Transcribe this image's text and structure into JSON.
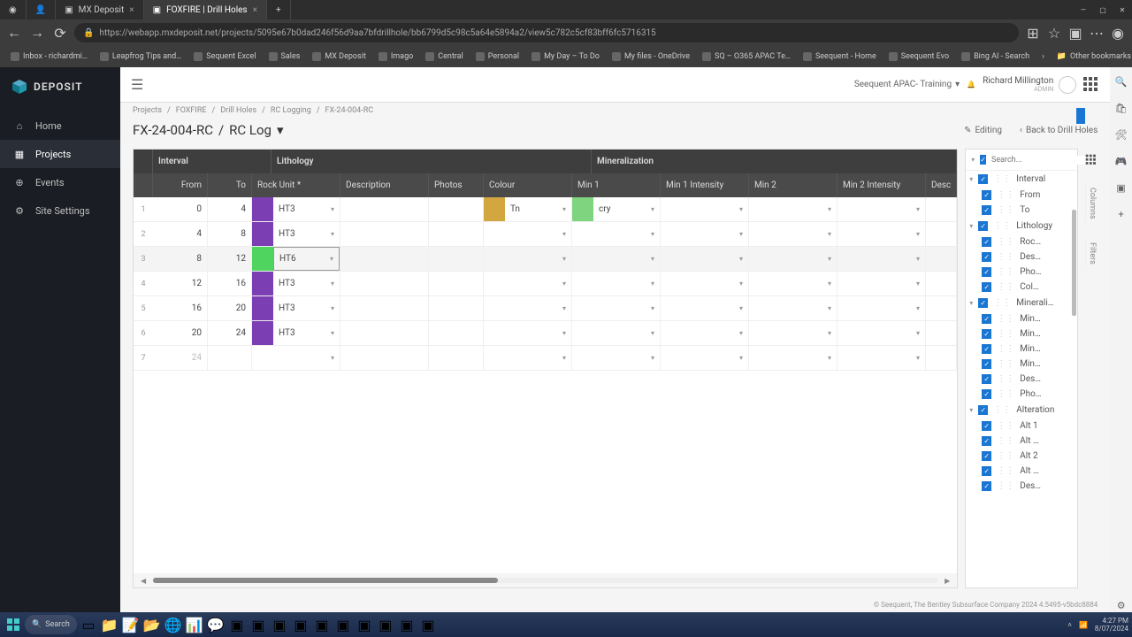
{
  "browser": {
    "tabs": [
      {
        "title": "MX Deposit",
        "active": false
      },
      {
        "title": "FOXFIRE | Drill Holes",
        "active": true
      }
    ],
    "url": "https://webapp.mxdeposit.net/projects/5095e67b0dad246f56d9aa7bfdrillhole/bb6799d5c98c5a64e5894a2/view5c782c5cf83bff6fc5716315",
    "bookmarks": [
      "Inbox - richardmi…",
      "Leapfrog Tips and…",
      "Sequent Excel",
      "Sales",
      "MX Deposit",
      "Imago",
      "Central",
      "Personal",
      "My Day – To Do",
      "My files - OneDrive",
      "SQ – O365 APAC Te…",
      "Seequent - Home",
      "Seequent Evo",
      "Bing AI - Search"
    ],
    "other_bookmarks": "Other bookmarks"
  },
  "app": {
    "logo_text": "DEPOSIT",
    "nav": [
      {
        "label": "Home"
      },
      {
        "label": "Projects",
        "active": true
      },
      {
        "label": "Events"
      },
      {
        "label": "Site Settings"
      }
    ],
    "org_selector": "Seequent APAC- Training",
    "user": {
      "name": "Richard Millington",
      "role": "ADMIN"
    }
  },
  "breadcrumb": [
    "Projects",
    "FOXFIRE",
    "Drill Holes",
    "RC Logging",
    "FX-24-004-RC"
  ],
  "page": {
    "title_a": "FX-24-004-RC",
    "title_b": "RC Log",
    "editing_label": "Editing",
    "back_label": "Back to Drill Holes"
  },
  "table": {
    "groups": [
      "Interval",
      "Lithology",
      "Mineralization"
    ],
    "columns": [
      "From",
      "To",
      "Rock Unit *",
      "Description",
      "Photos",
      "Colour",
      "Min 1",
      "Min 1 Intensity",
      "Min 2",
      "Min 2 Intensity",
      "Desc"
    ],
    "rows": [
      {
        "idx": 1,
        "from": 0,
        "to": 4,
        "rock": "HT3",
        "rock_color": "#7b3fb3",
        "colour": "Tn",
        "colour_swatch": "#d4a640",
        "min1": "cry",
        "min1_swatch": "#7fd47f"
      },
      {
        "idx": 2,
        "from": 4,
        "to": 8,
        "rock": "HT3",
        "rock_color": "#7b3fb3"
      },
      {
        "idx": 3,
        "from": 8,
        "to": 12,
        "rock": "HT6",
        "rock_color": "#4fd45f",
        "selected": true
      },
      {
        "idx": 4,
        "from": 12,
        "to": 16,
        "rock": "HT3",
        "rock_color": "#7b3fb3"
      },
      {
        "idx": 5,
        "from": 16,
        "to": 20,
        "rock": "HT3",
        "rock_color": "#7b3fb3"
      },
      {
        "idx": 6,
        "from": 20,
        "to": 24,
        "rock": "HT3",
        "rock_color": "#7b3fb3"
      }
    ],
    "ghost_row": {
      "idx": 7,
      "from": 24
    }
  },
  "columns_panel": {
    "search_placeholder": "Search...",
    "groups": [
      {
        "label": "Interval",
        "items": [
          "From",
          "To"
        ]
      },
      {
        "label": "Lithology",
        "items": [
          "Roc…",
          "Des…",
          "Pho…",
          "Col…"
        ]
      },
      {
        "label": "Minerali…",
        "items": [
          "Min…",
          "Min…",
          "Min…",
          "Min…",
          "Des…",
          "Pho…"
        ]
      },
      {
        "label": "Alteration",
        "items": [
          "Alt 1",
          "Alt …",
          "Alt 2",
          "Alt …",
          "Des…"
        ]
      }
    ],
    "side_tabs": [
      "Columns",
      "Filters"
    ]
  },
  "footer": "© Seequent, The Bentley Subsurface Company 2024 4.5495-v5bdc8884",
  "taskbar": {
    "search": "Search",
    "time": "4:27 PM",
    "date": "8/07/2024"
  }
}
